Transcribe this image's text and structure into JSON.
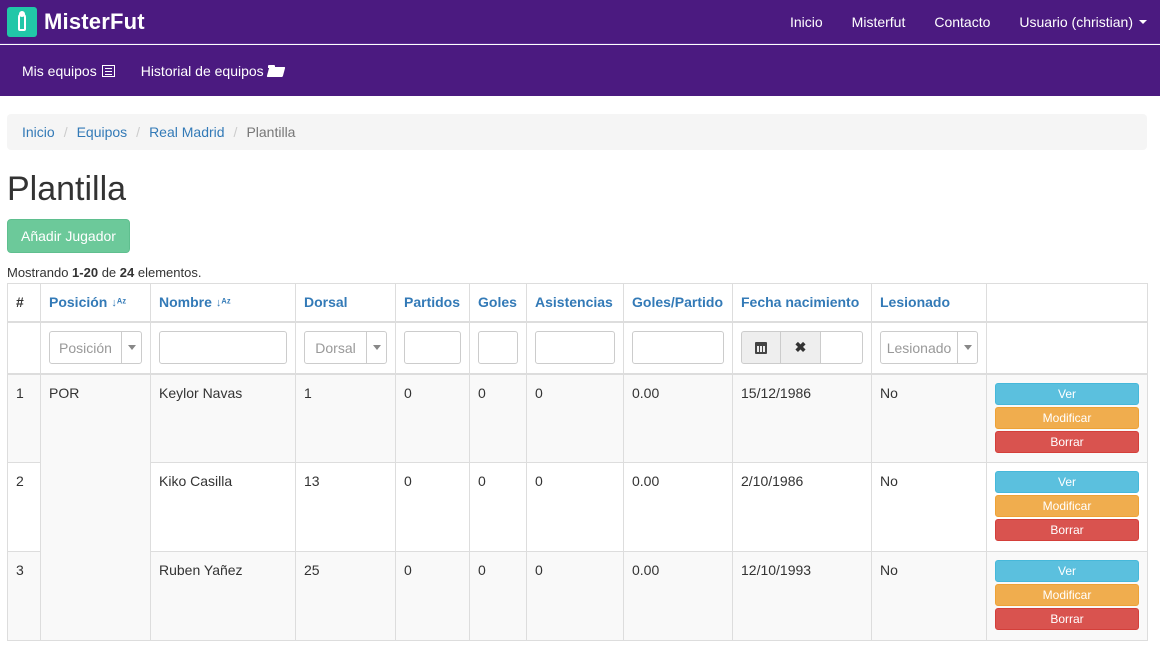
{
  "brand": {
    "name": "MisterFut"
  },
  "topnav": {
    "home": "Inicio",
    "misterfut": "Misterfut",
    "contact": "Contacto",
    "user": "Usuario (christian)"
  },
  "subnav": {
    "my_teams": "Mis equipos",
    "history": "Historial de equipos"
  },
  "breadcrumb": {
    "home": "Inicio",
    "teams": "Equipos",
    "team": "Real Madrid",
    "current": "Plantilla",
    "separator": "/"
  },
  "page": {
    "title": "Plantilla",
    "add_button": "Añadir Jugador"
  },
  "summary": {
    "prefix": "Mostrando ",
    "range": "1-20",
    "middle": " de ",
    "total": "24",
    "suffix": " elementos."
  },
  "table": {
    "headers": [
      "#",
      "Posición",
      "Nombre",
      "Dorsal",
      "Partidos",
      "Goles",
      "Asistencias",
      "Goles/Partido",
      "Fecha nacimiento",
      "Lesionado"
    ],
    "filters": {
      "position_placeholder": "Posición",
      "dorsal_placeholder": "Dorsal",
      "injured_placeholder": "Lesionado"
    },
    "rows": [
      {
        "num": "1",
        "pos": "POR",
        "name": "Keylor Navas",
        "dorsal": "1",
        "matches": "0",
        "goals": "0",
        "assists": "0",
        "gpm": "0.00",
        "birth": "15/12/1986",
        "injured": "No"
      },
      {
        "num": "2",
        "pos": "",
        "name": "Kiko Casilla",
        "dorsal": "13",
        "matches": "0",
        "goals": "0",
        "assists": "0",
        "gpm": "0.00",
        "birth": "2/10/1986",
        "injured": "No"
      },
      {
        "num": "3",
        "pos": "",
        "name": "Ruben Yañez",
        "dorsal": "25",
        "matches": "0",
        "goals": "0",
        "assists": "0",
        "gpm": "0.00",
        "birth": "12/10/1993",
        "injured": "No"
      }
    ],
    "actions": {
      "view": "Ver",
      "edit": "Modificar",
      "delete": "Borrar"
    }
  },
  "colors": {
    "navbar": "#4b1a80",
    "brand_logo": "#21c7a8",
    "link": "#337ab7",
    "add_button": "#6cc99a",
    "view": "#5bc0de",
    "edit": "#f0ad4e",
    "delete": "#d9534f"
  },
  "icons": {
    "logo": "player-icon",
    "my_teams": "list-icon",
    "history": "folder-open-icon",
    "sort": "sort-alpha-icon",
    "calendar": "calendar-icon",
    "clear": "close-icon",
    "dropdown": "caret-down-icon"
  }
}
